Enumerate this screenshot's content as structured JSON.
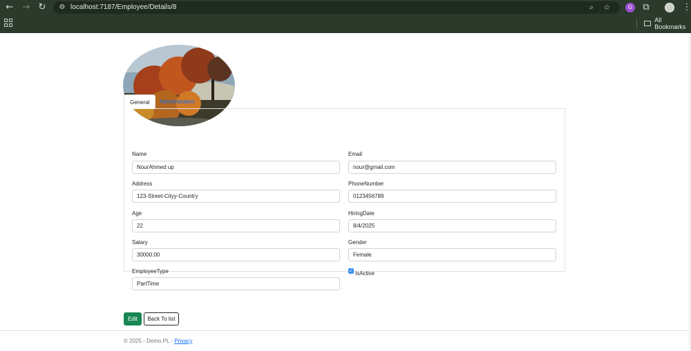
{
  "browser": {
    "url": "localhost:7187/Employee/Details/8",
    "bookmarks_label": "All Bookmarks",
    "extension_letter": "G"
  },
  "tabs": [
    {
      "label": "General"
    },
    {
      "label": "Administration"
    }
  ],
  "fields": {
    "name": {
      "label": "Name",
      "value": "NourAhmed up"
    },
    "email": {
      "label": "Email",
      "value": "nour@gmail.com"
    },
    "address": {
      "label": "Address",
      "value": "123-Street-Cityy-Country"
    },
    "phone": {
      "label": "PhoneNumber",
      "value": "0123456789"
    },
    "age": {
      "label": "Age",
      "value": "22"
    },
    "hiring_date": {
      "label": "HiringDate",
      "value": "8/4/2025"
    },
    "salary": {
      "label": "Salary",
      "value": "30000.00"
    },
    "gender": {
      "label": "Gender",
      "value": "Female"
    },
    "employee_type": {
      "label": "EmployeeType",
      "value": "PartTime"
    }
  },
  "is_active": {
    "label": "IsActive",
    "checked": true
  },
  "actions": {
    "edit_label": "Edit",
    "back_label": "Back To list"
  },
  "footer": {
    "text": "© 2025 - Demo.PL - ",
    "privacy_label": "Privacy"
  },
  "colors": {
    "primary": "#0d6efd",
    "success": "#198754",
    "chrome": "#2b3a2a"
  }
}
